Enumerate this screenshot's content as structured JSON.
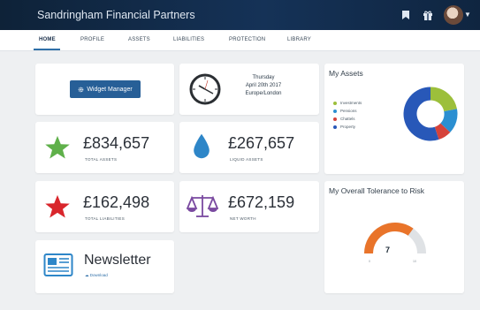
{
  "app": {
    "title": "Sandringham Financial Partners"
  },
  "nav": {
    "tabs": [
      {
        "label": "HOME"
      },
      {
        "label": "PROFILE"
      },
      {
        "label": "ASSETS"
      },
      {
        "label": "LIABILITIES"
      },
      {
        "label": "PROTECTION"
      },
      {
        "label": "LIBRARY"
      }
    ],
    "active_tab": "HOME"
  },
  "header_icons": [
    "bookmark-icon",
    "gift-icon",
    "user-avatar"
  ],
  "widget_manager": {
    "label": "Widget Manager",
    "icon": "gear-icon"
  },
  "clock": {
    "day": "Thursday",
    "date": "April 20th 2017",
    "timezone": "Europe/London"
  },
  "total_assets": {
    "value": "£834,657",
    "label": "TOTAL ASSETS",
    "icon": "star-icon",
    "color": "#5fb04a"
  },
  "liquid_assets": {
    "value": "£267,657",
    "label": "LIQUID ASSETS",
    "icon": "water-drop-icon",
    "color": "#2e86c8"
  },
  "total_liabilities": {
    "value": "£162,498",
    "label": "TOTAL LIABILITIES",
    "icon": "star-icon",
    "color": "#d9262c"
  },
  "net_worth": {
    "value": "£672,159",
    "label": "NET WORTH",
    "icon": "scales-icon",
    "color": "#7a4aa0"
  },
  "newsletter": {
    "title": "Newsletter",
    "download_label": "Download",
    "icon": "newspaper-icon"
  },
  "my_assets": {
    "title": "My Assets",
    "chart_data": {
      "type": "pie",
      "categories": [
        "Investments",
        "Pensions",
        "Chattels",
        "Property"
      ],
      "values": [
        22,
        15,
        8,
        55
      ],
      "colors": [
        "#9cbf3b",
        "#2b8fd1",
        "#d5423a",
        "#2858b8"
      ]
    }
  },
  "risk": {
    "title": "My Overall Tolerance to Risk",
    "value": "7",
    "min": "0",
    "max": "10",
    "fill_fraction": 0.7,
    "colors": {
      "fill": "#e9742a",
      "track": "#dfe2e5"
    }
  }
}
